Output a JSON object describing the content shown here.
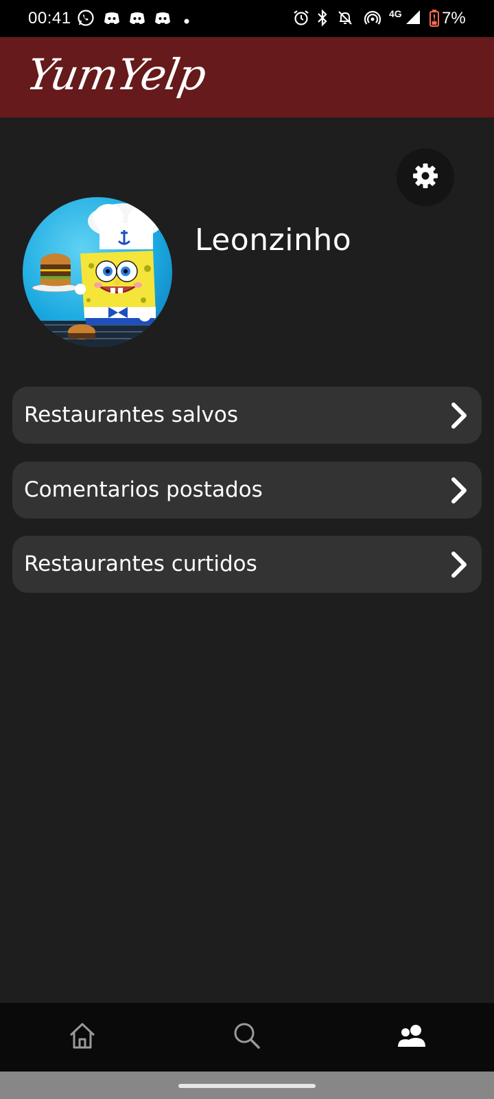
{
  "status_bar": {
    "time": "00:41",
    "network": "4G",
    "battery": "7%",
    "icons": [
      "whatsapp-icon",
      "discord-icon",
      "discord-icon",
      "discord-icon",
      "dot-icon",
      "alarm-icon",
      "bluetooth-icon",
      "notifications-off-icon",
      "hotspot-icon",
      "signal-icon",
      "battery-low-icon"
    ]
  },
  "header": {
    "app_name": "YumYelp",
    "color": "#661a1b"
  },
  "profile": {
    "username": "Leonzinho",
    "settings_icon": "gear-icon"
  },
  "menu": {
    "items": [
      {
        "label": "Restaurantes salvos",
        "icon": "chevron-right-icon"
      },
      {
        "label": "Comentarios postados",
        "icon": "chevron-right-icon"
      },
      {
        "label": "Restaurantes curtidos",
        "icon": "chevron-right-icon"
      }
    ]
  },
  "bottom_nav": {
    "items": [
      {
        "name": "home",
        "icon": "home-icon",
        "active": false
      },
      {
        "name": "search",
        "icon": "search-icon",
        "active": false
      },
      {
        "name": "profile",
        "icon": "users-icon",
        "active": true
      }
    ]
  },
  "colors": {
    "background": "#1e1e1e",
    "card": "#333333",
    "accent": "#661a1b"
  }
}
